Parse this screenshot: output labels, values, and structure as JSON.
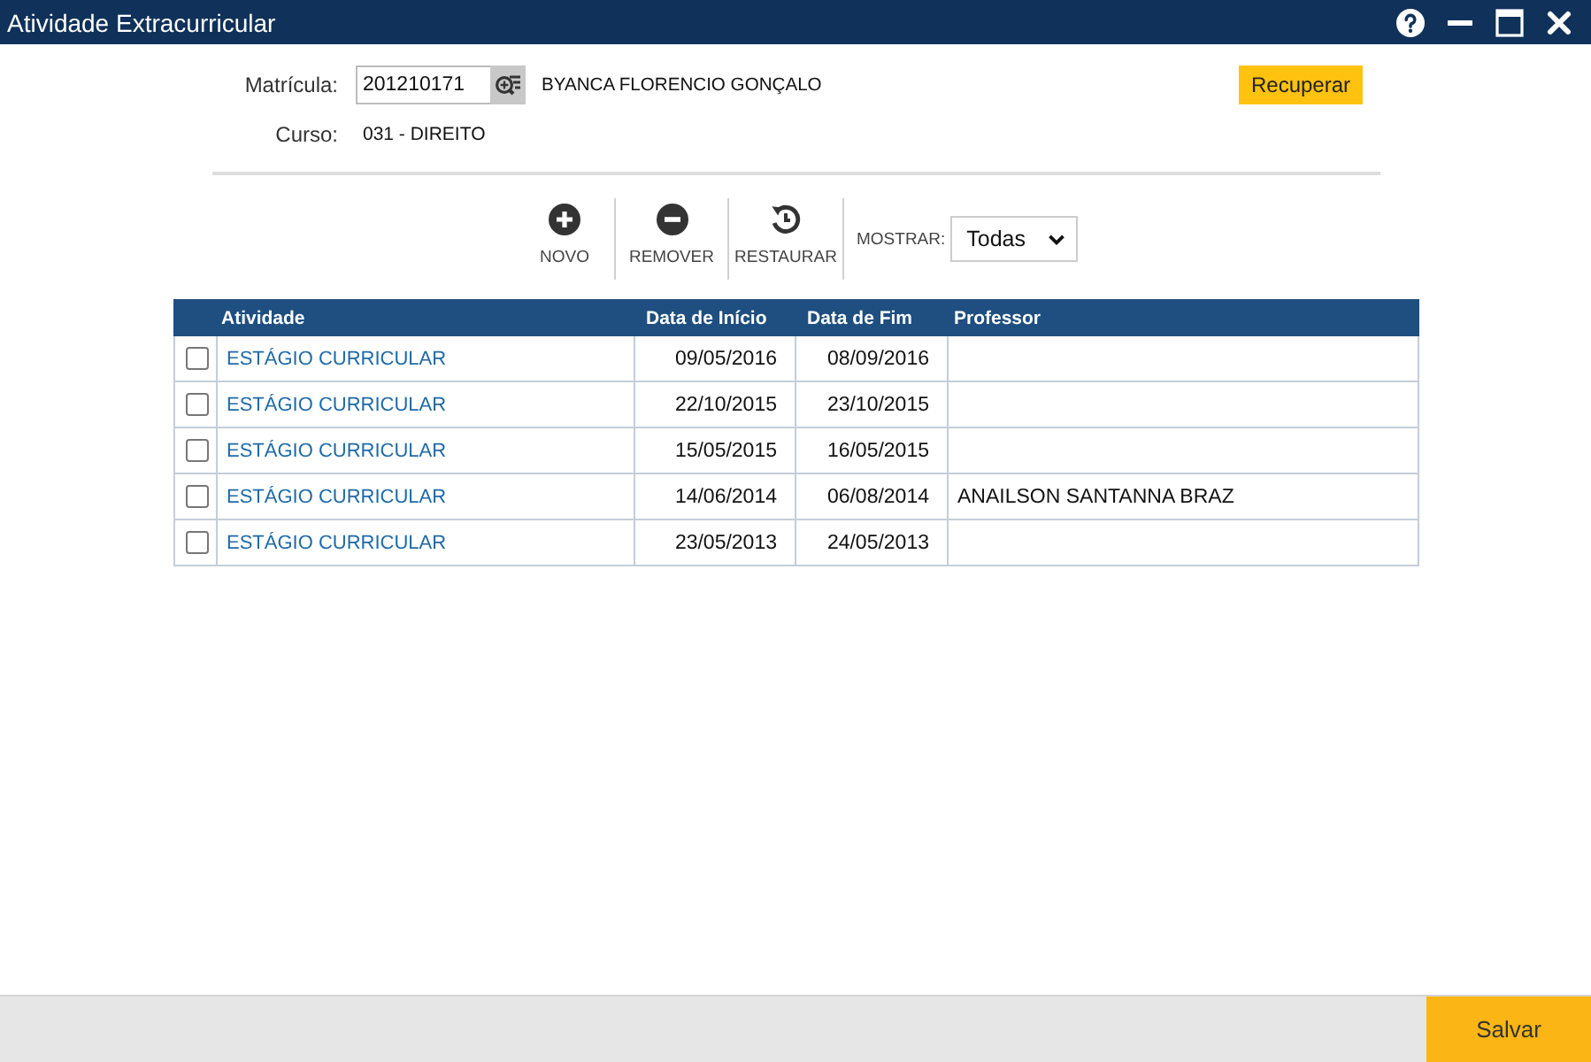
{
  "window": {
    "title": "Atividade Extracurricular"
  },
  "form": {
    "matricula": {
      "label": "Matrícula:",
      "value": "201210171"
    },
    "student_name": "BYANCA FLORENCIO GONÇALO",
    "recover_button": "Recuperar",
    "curso": {
      "label": "Curso:",
      "value": "031 - DIREITO"
    }
  },
  "toolbar": {
    "buttons": [
      {
        "kind": "add",
        "label": "NOVO"
      },
      {
        "kind": "remove",
        "label": "REMOVER"
      },
      {
        "kind": "restore",
        "label": "RESTAURAR"
      }
    ],
    "filter": {
      "label": "MOSTRAR:",
      "value": "Todas"
    }
  },
  "table": {
    "columns": [
      "Atividade",
      "Data de Início",
      "Data de Fim",
      "Professor"
    ],
    "rows": [
      {
        "checked": false,
        "cells": [
          "ESTÁGIO CURRICULAR",
          "09/05/2016",
          "08/09/2016",
          ""
        ]
      },
      {
        "checked": false,
        "cells": [
          "ESTÁGIO CURRICULAR",
          "22/10/2015",
          "23/10/2015",
          ""
        ]
      },
      {
        "checked": false,
        "cells": [
          "ESTÁGIO CURRICULAR",
          "15/05/2015",
          "16/05/2015",
          ""
        ]
      },
      {
        "checked": false,
        "cells": [
          "ESTÁGIO CURRICULAR",
          "14/06/2014",
          "06/08/2014",
          "ANAILSON SANTANNA BRAZ"
        ]
      },
      {
        "checked": false,
        "cells": [
          "ESTÁGIO CURRICULAR",
          "23/05/2013",
          "24/05/2013",
          ""
        ]
      }
    ]
  },
  "footer": {
    "save_button": "Salvar"
  }
}
